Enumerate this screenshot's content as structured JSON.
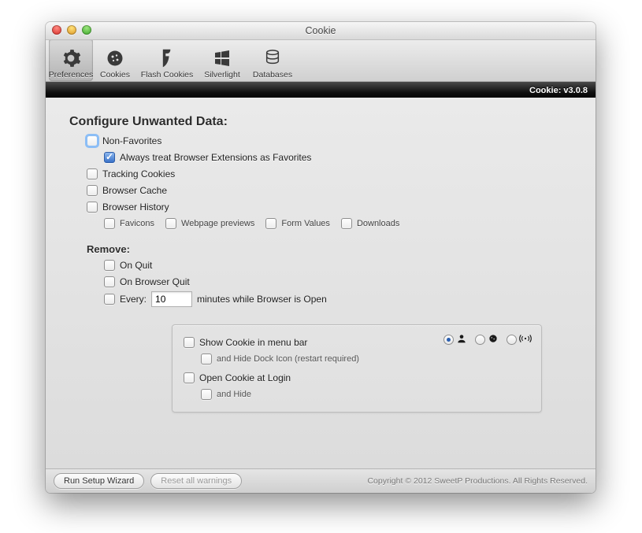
{
  "window": {
    "title": "Cookie",
    "version_label": "Cookie: v3.0.8"
  },
  "toolbar": {
    "preferences": "Preferences",
    "cookies": "Cookies",
    "flash_cookies": "Flash Cookies",
    "silverlight": "Silverlight",
    "databases": "Databases"
  },
  "configure": {
    "heading": "Configure Unwanted Data:",
    "non_favorites": "Non-Favorites",
    "extensions_as_favorites": "Always treat Browser Extensions as Favorites",
    "tracking_cookies": "Tracking Cookies",
    "browser_cache": "Browser Cache",
    "browser_history": "Browser History",
    "history_sub": {
      "favicons": "Favicons",
      "webpage_previews": "Webpage previews",
      "form_values": "Form Values",
      "downloads": "Downloads"
    }
  },
  "remove": {
    "heading": "Remove:",
    "on_quit": "On Quit",
    "on_browser_quit": "On Browser Quit",
    "every_prefix": "Every:",
    "interval_value": "10",
    "every_suffix": "minutes while Browser is Open"
  },
  "menu_box": {
    "show_in_menu_bar": "Show Cookie in menu bar",
    "hide_dock_icon": "and Hide Dock Icon (restart required)",
    "open_at_login": "Open Cookie at Login",
    "and_hide": "and Hide"
  },
  "footer": {
    "run_setup_wizard": "Run Setup Wizard",
    "reset_warnings": "Reset all warnings",
    "copyright": "Copyright © 2012 SweetP Productions. All Rights Reserved."
  }
}
